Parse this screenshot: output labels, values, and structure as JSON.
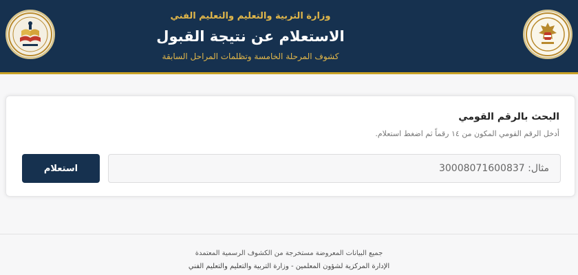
{
  "header": {
    "ministry": "وزارة التربية والتعليم والتعليم الفني",
    "title": "الاستعلام عن نتيجة القبول",
    "subtitle": "كشوف المرحلة الخامسة وتظلمات المراحل السابقة",
    "colors": {
      "background": "#16314f",
      "accent": "#e0b64a"
    }
  },
  "search": {
    "title": "البحث بالرقم القومي",
    "description": "أدخل الرقم القومي المكون من ١٤ رقماً ثم اضغط استعلام.",
    "placeholder": "مثال: 30008071600837",
    "button_label": "استعلام"
  },
  "footer": {
    "line1": "جميع البيانات المعروضة مستخرجة من الكشوف الرسمية المعتمدة",
    "line2": "الإدارة المركزية لشؤون المعلمين - وزارة التربية والتعليم والتعليم الفني"
  }
}
